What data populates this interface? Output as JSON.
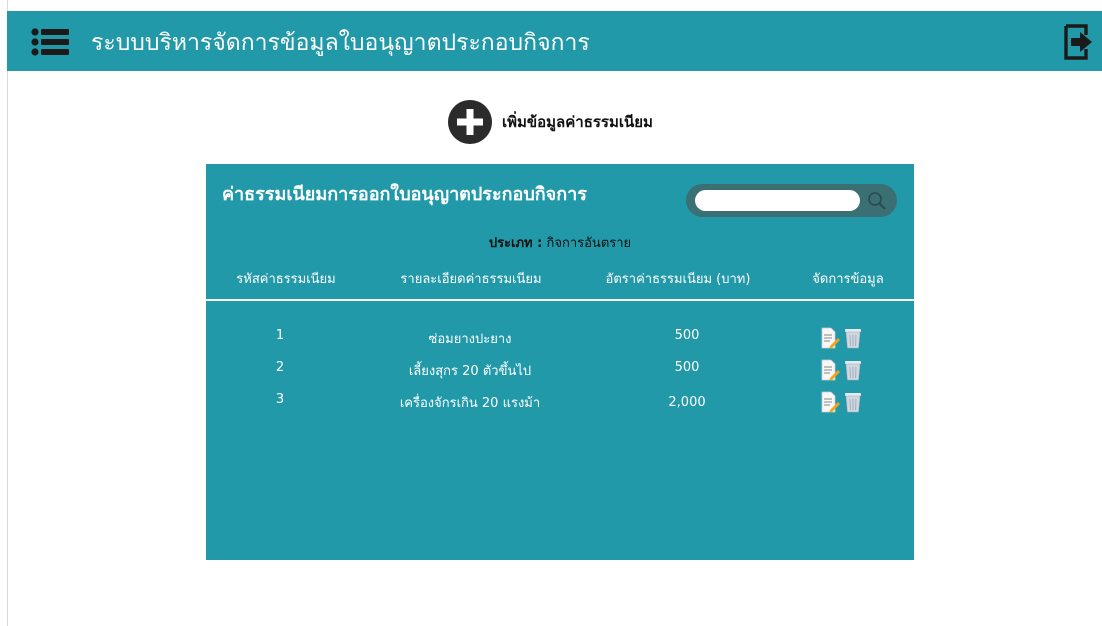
{
  "header": {
    "title": "ระบบบริหารจัดการข้อมูลใบอนุญาตประกอบกิจการ",
    "menu_icon": "list-menu-icon",
    "logout_icon": "logout-icon"
  },
  "add_button": {
    "label": "เพิ่มข้อมูลค่าธรรมเนียม",
    "icon": "plus-circle-icon"
  },
  "panel": {
    "title": "ค่าธรรมเนียมการออกใบอนุญาตประกอบกิจการ",
    "search": {
      "value": "",
      "placeholder": ""
    },
    "type_label": "ประเภท :",
    "type_value": "กิจการอันตราย",
    "columns": [
      "รหัสค่าธรรมเนียม",
      "รายละเอียดค่าธรรมเนียม",
      "อัตราค่าธรรมเนียม (บาท)",
      "จัดการข้อมูล"
    ],
    "rows": [
      {
        "id": "1",
        "detail": "ซ่อมยางปะยาง",
        "rate": "500"
      },
      {
        "id": "2",
        "detail": "เลี้ยงสุกร 20 ตัวขึ้นไป",
        "rate": "500"
      },
      {
        "id": "3",
        "detail": "เครื่องจักรเกิน 20 แรงม้า",
        "rate": "2,000"
      }
    ]
  },
  "colors": {
    "teal": "#2199a9",
    "search_bg": "#3a6f74",
    "dark_icon": "#2b2b2b"
  }
}
